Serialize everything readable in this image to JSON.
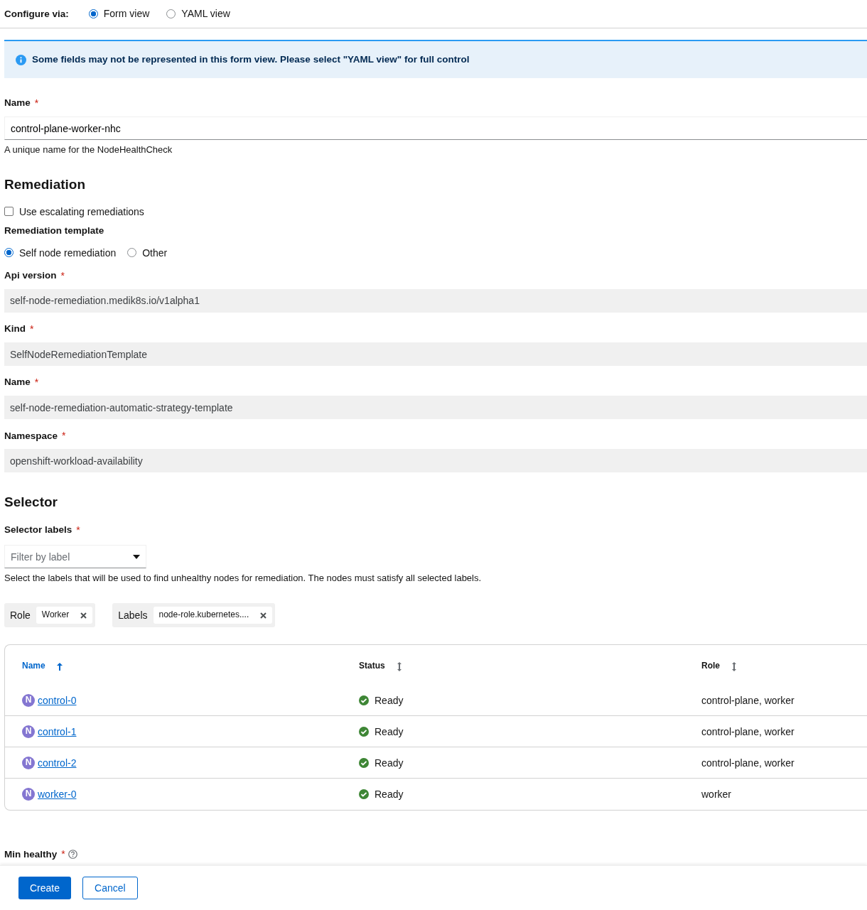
{
  "configure": {
    "label": "Configure via:",
    "options": [
      {
        "label": "Form view",
        "selected": true
      },
      {
        "label": "YAML view",
        "selected": false
      }
    ]
  },
  "alert": {
    "text": "Some fields may not be represented in this form view. Please select \"YAML view\" for full control"
  },
  "name_field": {
    "label": "Name",
    "mark": "*",
    "value": "control-plane-worker-nhc",
    "helper": "A unique name for the NodeHealthCheck"
  },
  "remediation": {
    "title": "Remediation",
    "escalating": {
      "label": "Use escalating remediations",
      "checked": false
    },
    "template_label": "Remediation template",
    "template_options": [
      {
        "label": "Self node remediation",
        "selected": true
      },
      {
        "label": "Other",
        "selected": false
      }
    ],
    "fields": [
      {
        "label": "Api version",
        "mark": "*",
        "value": "self-node-remediation.medik8s.io/v1alpha1",
        "disabled": true
      },
      {
        "label": "Kind",
        "mark": "*",
        "value": "SelfNodeRemediationTemplate",
        "disabled": true
      },
      {
        "label": "Name",
        "mark": "*",
        "value": "self-node-remediation-automatic-strategy-template",
        "disabled": true
      },
      {
        "label": "Namespace",
        "mark": "*",
        "value": "openshift-workload-availability",
        "disabled": true
      }
    ]
  },
  "selector": {
    "title": "Selector",
    "labels_label": "Selector labels",
    "mark": "*",
    "filter": {
      "placeholder": "Filter by label"
    },
    "helper": "Select the labels that will be used to find unhealthy nodes for remediation. The nodes must satisfy all selected labels.",
    "chip_groups": [
      {
        "category": "Role",
        "chips": [
          "Worker"
        ]
      },
      {
        "category": "Labels",
        "chips": [
          "node-role.kubernetes...."
        ]
      }
    ],
    "table": {
      "columns": [
        {
          "label": "Name",
          "sorted": true
        },
        {
          "label": "Status",
          "sorted": false
        },
        {
          "label": "Role",
          "sorted": false
        }
      ],
      "rows": [
        {
          "badge": "N",
          "name": "control-0",
          "status": "Ready",
          "role": "control-plane, worker"
        },
        {
          "badge": "N",
          "name": "control-1",
          "status": "Ready",
          "role": "control-plane, worker"
        },
        {
          "badge": "N",
          "name": "control-2",
          "status": "Ready",
          "role": "control-plane, worker"
        },
        {
          "badge": "N",
          "name": "worker-0",
          "status": "Ready",
          "role": "worker"
        }
      ]
    }
  },
  "min_healthy": {
    "label": "Min healthy",
    "mark": "*"
  },
  "buttons": [
    {
      "label": "Create",
      "kind": "primary"
    },
    {
      "label": "Cancel",
      "kind": "secondary"
    }
  ]
}
